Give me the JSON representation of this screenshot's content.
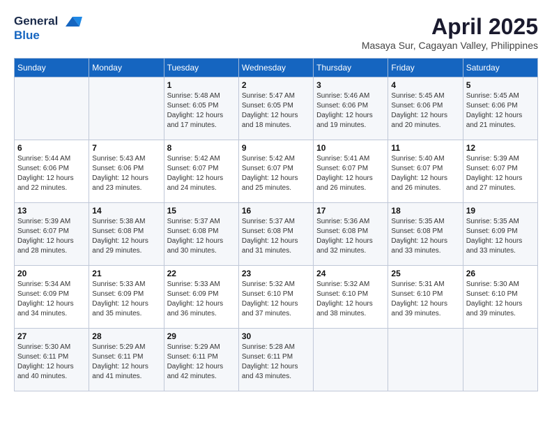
{
  "header": {
    "logo_line1": "General",
    "logo_line2": "Blue",
    "month_title": "April 2025",
    "location": "Masaya Sur, Cagayan Valley, Philippines"
  },
  "days_of_week": [
    "Sunday",
    "Monday",
    "Tuesday",
    "Wednesday",
    "Thursday",
    "Friday",
    "Saturday"
  ],
  "weeks": [
    [
      {
        "day": "",
        "info": ""
      },
      {
        "day": "",
        "info": ""
      },
      {
        "day": "1",
        "info": "Sunrise: 5:48 AM\nSunset: 6:05 PM\nDaylight: 12 hours and 17 minutes."
      },
      {
        "day": "2",
        "info": "Sunrise: 5:47 AM\nSunset: 6:05 PM\nDaylight: 12 hours and 18 minutes."
      },
      {
        "day": "3",
        "info": "Sunrise: 5:46 AM\nSunset: 6:06 PM\nDaylight: 12 hours and 19 minutes."
      },
      {
        "day": "4",
        "info": "Sunrise: 5:45 AM\nSunset: 6:06 PM\nDaylight: 12 hours and 20 minutes."
      },
      {
        "day": "5",
        "info": "Sunrise: 5:45 AM\nSunset: 6:06 PM\nDaylight: 12 hours and 21 minutes."
      }
    ],
    [
      {
        "day": "6",
        "info": "Sunrise: 5:44 AM\nSunset: 6:06 PM\nDaylight: 12 hours and 22 minutes."
      },
      {
        "day": "7",
        "info": "Sunrise: 5:43 AM\nSunset: 6:06 PM\nDaylight: 12 hours and 23 minutes."
      },
      {
        "day": "8",
        "info": "Sunrise: 5:42 AM\nSunset: 6:07 PM\nDaylight: 12 hours and 24 minutes."
      },
      {
        "day": "9",
        "info": "Sunrise: 5:42 AM\nSunset: 6:07 PM\nDaylight: 12 hours and 25 minutes."
      },
      {
        "day": "10",
        "info": "Sunrise: 5:41 AM\nSunset: 6:07 PM\nDaylight: 12 hours and 26 minutes."
      },
      {
        "day": "11",
        "info": "Sunrise: 5:40 AM\nSunset: 6:07 PM\nDaylight: 12 hours and 26 minutes."
      },
      {
        "day": "12",
        "info": "Sunrise: 5:39 AM\nSunset: 6:07 PM\nDaylight: 12 hours and 27 minutes."
      }
    ],
    [
      {
        "day": "13",
        "info": "Sunrise: 5:39 AM\nSunset: 6:07 PM\nDaylight: 12 hours and 28 minutes."
      },
      {
        "day": "14",
        "info": "Sunrise: 5:38 AM\nSunset: 6:08 PM\nDaylight: 12 hours and 29 minutes."
      },
      {
        "day": "15",
        "info": "Sunrise: 5:37 AM\nSunset: 6:08 PM\nDaylight: 12 hours and 30 minutes."
      },
      {
        "day": "16",
        "info": "Sunrise: 5:37 AM\nSunset: 6:08 PM\nDaylight: 12 hours and 31 minutes."
      },
      {
        "day": "17",
        "info": "Sunrise: 5:36 AM\nSunset: 6:08 PM\nDaylight: 12 hours and 32 minutes."
      },
      {
        "day": "18",
        "info": "Sunrise: 5:35 AM\nSunset: 6:08 PM\nDaylight: 12 hours and 33 minutes."
      },
      {
        "day": "19",
        "info": "Sunrise: 5:35 AM\nSunset: 6:09 PM\nDaylight: 12 hours and 33 minutes."
      }
    ],
    [
      {
        "day": "20",
        "info": "Sunrise: 5:34 AM\nSunset: 6:09 PM\nDaylight: 12 hours and 34 minutes."
      },
      {
        "day": "21",
        "info": "Sunrise: 5:33 AM\nSunset: 6:09 PM\nDaylight: 12 hours and 35 minutes."
      },
      {
        "day": "22",
        "info": "Sunrise: 5:33 AM\nSunset: 6:09 PM\nDaylight: 12 hours and 36 minutes."
      },
      {
        "day": "23",
        "info": "Sunrise: 5:32 AM\nSunset: 6:10 PM\nDaylight: 12 hours and 37 minutes."
      },
      {
        "day": "24",
        "info": "Sunrise: 5:32 AM\nSunset: 6:10 PM\nDaylight: 12 hours and 38 minutes."
      },
      {
        "day": "25",
        "info": "Sunrise: 5:31 AM\nSunset: 6:10 PM\nDaylight: 12 hours and 39 minutes."
      },
      {
        "day": "26",
        "info": "Sunrise: 5:30 AM\nSunset: 6:10 PM\nDaylight: 12 hours and 39 minutes."
      }
    ],
    [
      {
        "day": "27",
        "info": "Sunrise: 5:30 AM\nSunset: 6:11 PM\nDaylight: 12 hours and 40 minutes."
      },
      {
        "day": "28",
        "info": "Sunrise: 5:29 AM\nSunset: 6:11 PM\nDaylight: 12 hours and 41 minutes."
      },
      {
        "day": "29",
        "info": "Sunrise: 5:29 AM\nSunset: 6:11 PM\nDaylight: 12 hours and 42 minutes."
      },
      {
        "day": "30",
        "info": "Sunrise: 5:28 AM\nSunset: 6:11 PM\nDaylight: 12 hours and 43 minutes."
      },
      {
        "day": "",
        "info": ""
      },
      {
        "day": "",
        "info": ""
      },
      {
        "day": "",
        "info": ""
      }
    ]
  ]
}
